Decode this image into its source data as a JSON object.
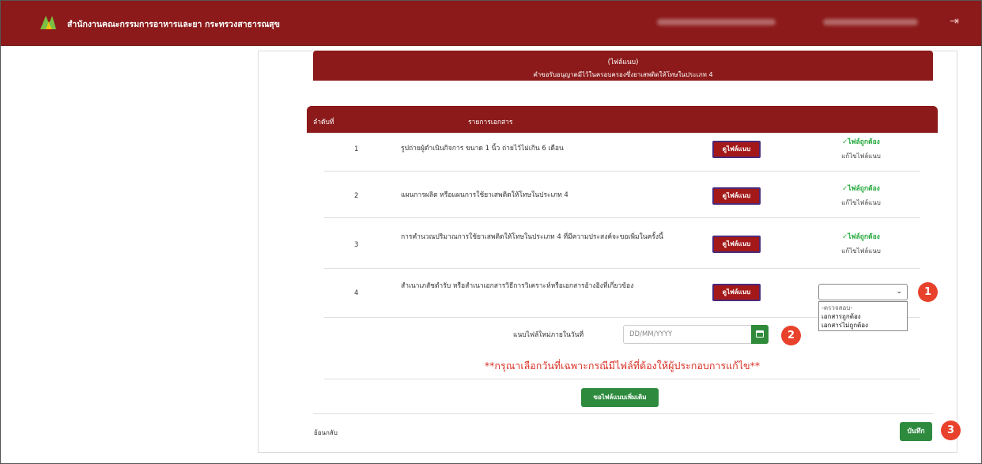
{
  "app": {
    "title": "สำนักงานคณะกรรมการอาหารและยา กระทรวงสาธารณสุข",
    "user_info_blurred": true,
    "accent": "#8c1a1a"
  },
  "doc": {
    "header_line1": "(ไฟล์แนบ)",
    "header_line2": "คำขอรับอนุญาตมีไว้ในครอบครองซึ่งยาเสพติดให้โทษในประเภท 4"
  },
  "table": {
    "col_no": "ลำดับที่",
    "col_doc": "รายการเอกสาร",
    "view_label": "ดูไฟล์แนบ",
    "status_ok": "✓ไฟล์ถูกต้อง",
    "status_edit": "แก้ไขไฟล์แนบ",
    "rows": [
      {
        "no": "1",
        "desc": "รูปถ่ายผู้ดำเนินกิจการ ขนาด 1 นิ้ว ถ่ายไว้ไม่เกิน 6 เดือน"
      },
      {
        "no": "2",
        "desc": "แผนการผลิต หรือแผนการใช้ยาเสพติดให้โทษในประเภท 4"
      },
      {
        "no": "3",
        "desc": "การคำนวณปริมาณการใช้ยาเสพติดให้โทษในประเภท 4 ที่มีความประสงค์จะขอเพิ่มในครั้งนี้"
      },
      {
        "no": "4",
        "desc": "สำเนาเภสัชตำรับ หรือสำเนาเอกสารวิธีการวิเคราะห์หรือเอกสารอ้างอิงที่เกี่ยวข้อง"
      }
    ]
  },
  "review": {
    "select_value": "",
    "options": [
      "-ตรวจสอบ-",
      "เอกสารถูกต้อง",
      "เอกสารไม่ถูกต้อง"
    ],
    "date_label": "แนบไฟล์ใหม่ภายในวันที่",
    "date_placeholder": "DD/MM/YYYY",
    "warning": "**กรุณาเลือกวันที่เฉพาะกรณีมีไฟล์ที่ต้องให้ผู้ประกอบการแก้ไข**",
    "more_button": "ขอไฟล์แนบเพิ่มเติม",
    "back_link": "ย้อนกลับ",
    "save_button": "บันทึก"
  },
  "badges": [
    "1",
    "2",
    "3"
  ]
}
